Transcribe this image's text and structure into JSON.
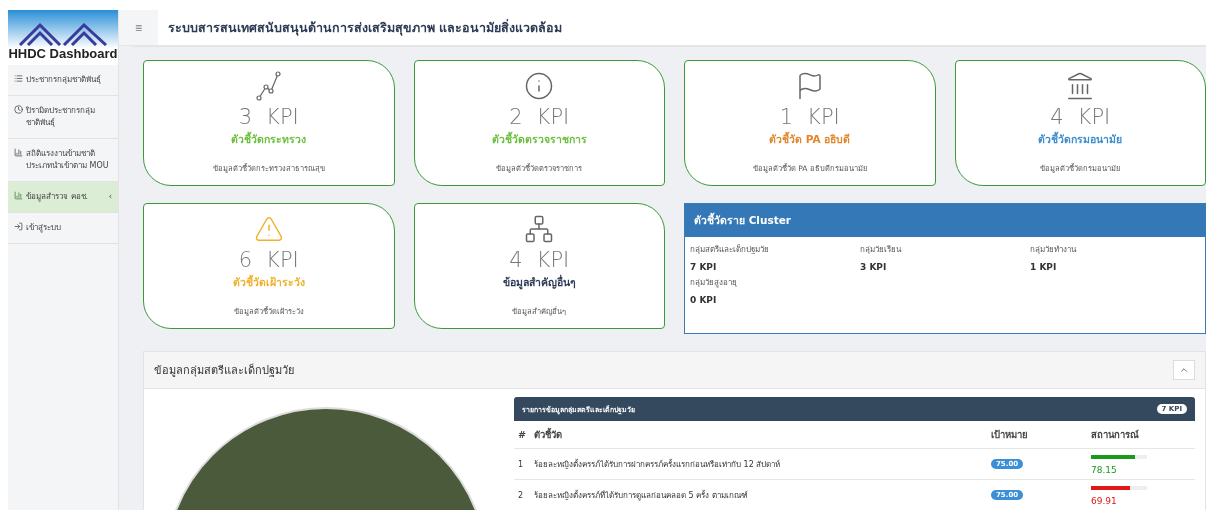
{
  "logo": {
    "text": "HHDC Dashboard"
  },
  "header": {
    "menu_glyph": "≡",
    "title": "ระบบสารสนเทศสนับสนุนด้านการส่งเสริมสุขภาพ และอนามัยสิ่งแวดล้อม"
  },
  "sidebar": {
    "items": [
      {
        "label": "ประชากรกลุ่มชาติพันธุ์",
        "selected": false
      },
      {
        "label": "ปิรามิดประชากรกลุ่มชาติพันธุ์",
        "selected": false
      },
      {
        "label": "สถิติแรงงานข้ามชาติประเภทนำเข้าตาม MOU",
        "selected": false
      },
      {
        "label": "ข้อมูลสำรวจ คอช.",
        "selected": true,
        "chevron": "‹"
      },
      {
        "label": "เข้าสู่ระบบ",
        "selected": false
      }
    ]
  },
  "kpi_cards": [
    {
      "count": "3",
      "unit": "KPI",
      "title": "ตัวชี้วัดกระทรวง",
      "subtitle": "ข้อมูลตัวชี้วัดกระทรวงสาธารณสุข",
      "color": "#6cbf3c"
    },
    {
      "count": "2",
      "unit": "KPI",
      "title": "ตัวชี้วัดตรวจราชการ",
      "subtitle": "ข้อมูลตัวชี้วัดตรวจราชการ",
      "color": "#6cbf3c"
    },
    {
      "count": "1",
      "unit": "KPI",
      "title": "ตัวชี้วัด PA อธิบดี",
      "subtitle": "ข้อมูลตัวชี้วัด PA อธิบดีกรมอนามัย",
      "color": "#e0872e"
    },
    {
      "count": "4",
      "unit": "KPI",
      "title": "ตัวชี้วัดกรมอนามัย",
      "subtitle": "ข้อมูลตัวชี้วัดกรมอนามัย",
      "color": "#3c8dcc"
    },
    {
      "count": "6",
      "unit": "KPI",
      "title": "ตัวชี้วัดเฝ้าระวัง",
      "subtitle": "ข้อมูลตัวชี้วัดเฝ้าระวัง",
      "color": "#f0b12a"
    },
    {
      "count": "4",
      "unit": "KPI",
      "title": "ข้อมูลสำคัญอื่นๆ",
      "subtitle": "ข้อมูลสำคัญอื่นๆ",
      "color": "#2e3b55"
    }
  ],
  "cluster_panel": {
    "title": "ตัวชี้วัดราย Cluster",
    "groups": [
      {
        "label": "กลุ่มสตรีและเด็กปฐมวัย",
        "value": "7 KPI"
      },
      {
        "label": "กลุ่มวัยเรียน",
        "value": "3 KPI"
      },
      {
        "label": "กลุ่มวัยทำงาน",
        "value": "1 KPI"
      },
      {
        "label": "กลุ่มวัยสูงอายุ",
        "value": "0 KPI"
      }
    ]
  },
  "section": {
    "title": "ข้อมูลกลุ่มสตรีและเด็กปฐมวัย",
    "table": {
      "title": "รายการข้อมูลกลุ่มสตรีและเด็กปฐมวัย",
      "badge": "7 KPI",
      "columns": [
        "#",
        "ตัวชี้วัด",
        "เป้าหมาย",
        "สถานการณ์"
      ],
      "rows": [
        {
          "no": "1",
          "name": "ร้อยละหญิงตั้งครรภ์ได้รับการฝากครรภ์ครั้งแรกก่อนหรือเท่ากับ 12 สัปดาห์",
          "target": "75.00",
          "level": 0.78,
          "result": "78.15",
          "color": "#1a9a1a"
        },
        {
          "no": "2",
          "name": "ร้อยละหญิงตั้งครรภ์ที่ได้รับการดูแลก่อนคลอด 5 ครั้ง ตามเกณฑ์",
          "target": "75.00",
          "level": 0.7,
          "result": "69.91",
          "color": "#e01818"
        }
      ]
    }
  }
}
